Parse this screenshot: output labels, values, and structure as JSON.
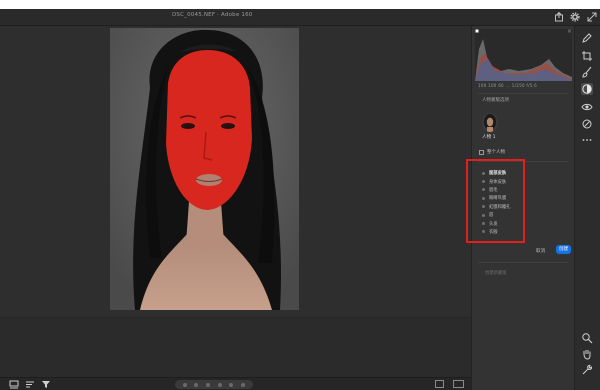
{
  "window": {
    "title": "DSC_0045.NEF   ·   Adobe 160"
  },
  "title_icons": {
    "export": "export-icon",
    "settings": "gear-icon",
    "expand": "expand-icon"
  },
  "histogram": {
    "readout": "100  100  60  ...  1/250  f/5.6"
  },
  "masking_panel": {
    "section_title": "人物蒙版选项",
    "person_label": "人物 1",
    "select_all_label": "整个人物",
    "parts": [
      {
        "label": "面部皮肤",
        "bold": true
      },
      {
        "label": "身体皮肤",
        "bold": false
      },
      {
        "label": "眉毛",
        "bold": false
      },
      {
        "label": "眼睛巩膜",
        "bold": false
      },
      {
        "label": "虹膜和瞳孔",
        "bold": false
      },
      {
        "label": "唇",
        "bold": false
      },
      {
        "label": "头发",
        "bold": false
      },
      {
        "label": "衣服",
        "bold": false
      }
    ],
    "cancel_label": "取消",
    "ok_label": "创建",
    "hint": "创建新蒙版"
  },
  "colors": {
    "accent_blue": "#1473e6",
    "mask_overlay": "#e02020",
    "highlight_box": "#e02020"
  },
  "rail_icons": [
    "edit-icon",
    "crop-icon",
    "brush-icon",
    "mask-icon",
    "eye-icon",
    "presets-icon",
    "more-icon",
    "zoom-icon",
    "hand-icon",
    "settings-icon"
  ],
  "bottom_icons": [
    "filmstrip-icon",
    "sort-icon",
    "filter-icon"
  ]
}
